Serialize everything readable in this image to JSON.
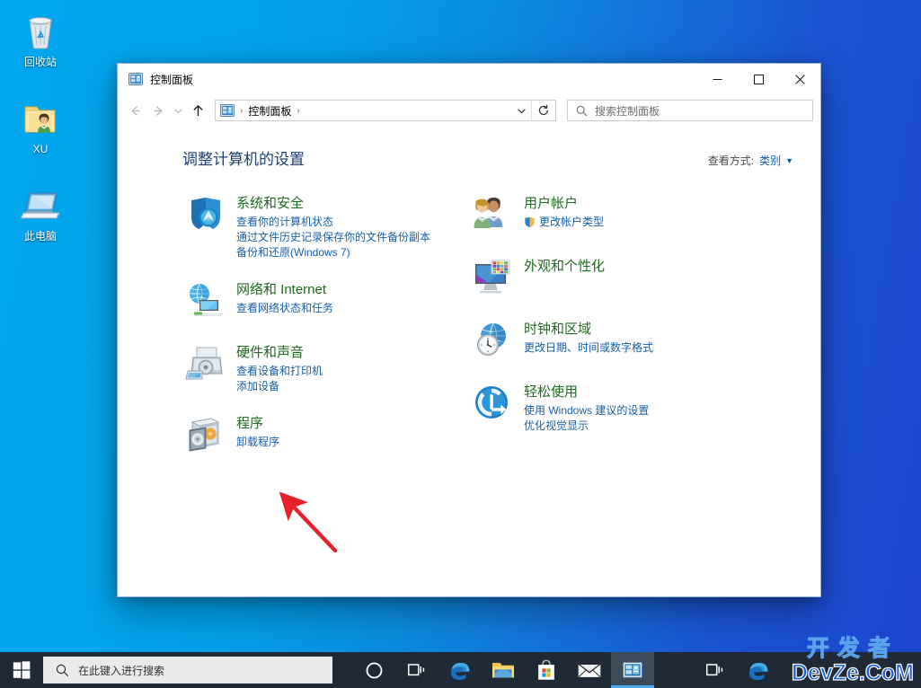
{
  "desktop": {
    "icons": [
      {
        "label": "回收站",
        "icon": "recycle-bin-icon"
      },
      {
        "label": "XU",
        "icon": "user-folder-icon"
      },
      {
        "label": "此电脑",
        "icon": "this-pc-icon"
      }
    ]
  },
  "window": {
    "title": "控制面板",
    "icon": "control-panel-icon",
    "controls": {
      "minimize": "minimize-icon",
      "maximize": "maximize-icon",
      "close": "close-icon"
    },
    "nav": {
      "back": "back-arrow-icon",
      "forward": "forward-arrow-icon",
      "recent": "recent-chevron-icon",
      "up": "up-arrow-icon",
      "refresh": "refresh-icon",
      "dropdown": "address-chevron-icon"
    },
    "address": {
      "icon": "control-panel-icon",
      "crumbs": [
        "控制面板"
      ],
      "separator": "›"
    },
    "search": {
      "icon": "search-icon",
      "placeholder": "搜索控制面板",
      "value": ""
    }
  },
  "main": {
    "heading": "调整计算机的设置",
    "view_by": {
      "label": "查看方式:",
      "value": "类别",
      "caret": "▼"
    },
    "left_column": [
      {
        "icon": "system-security-shield-icon",
        "title": "系统和安全",
        "links": [
          {
            "text": "查看你的计算机状态",
            "shield": false
          },
          {
            "text": "通过文件历史记录保存你的文件备份副本",
            "shield": false
          },
          {
            "text": "备份和还原(Windows 7)",
            "shield": false
          }
        ]
      },
      {
        "icon": "network-internet-icon",
        "title": "网络和 Internet",
        "links": [
          {
            "text": "查看网络状态和任务",
            "shield": false
          }
        ]
      },
      {
        "icon": "hardware-sound-printer-icon",
        "title": "硬件和声音",
        "links": [
          {
            "text": "查看设备和打印机",
            "shield": false
          },
          {
            "text": "添加设备",
            "shield": false
          }
        ]
      },
      {
        "icon": "programs-cd-box-icon",
        "title": "程序",
        "links": [
          {
            "text": "卸载程序",
            "shield": false
          }
        ]
      }
    ],
    "right_column": [
      {
        "icon": "user-accounts-people-icon",
        "title": "用户帐户",
        "links": [
          {
            "text": "更改帐户类型",
            "shield": true
          }
        ]
      },
      {
        "icon": "appearance-personalization-icon",
        "title": "外观和个性化",
        "links": []
      },
      {
        "icon": "clock-region-globe-icon",
        "title": "时钟和区域",
        "links": [
          {
            "text": "更改日期、时间或数字格式",
            "shield": false
          }
        ]
      },
      {
        "icon": "ease-of-access-icon",
        "title": "轻松使用",
        "links": [
          {
            "text": "使用 Windows 建议的设置",
            "shield": false
          },
          {
            "text": "优化视觉显示",
            "shield": false
          }
        ]
      }
    ]
  },
  "annotation": {
    "type": "red-arrow",
    "points_to": "程序",
    "color": "#e8202a"
  },
  "taskbar": {
    "start": "windows-start-icon",
    "search": {
      "icon": "search-icon",
      "placeholder": "在此键入进行搜索"
    },
    "buttons": [
      {
        "name": "cortana-icon",
        "active": false
      },
      {
        "name": "task-view-icon",
        "active": false
      },
      {
        "name": "edge-browser-icon",
        "active": false
      },
      {
        "name": "file-explorer-icon",
        "active": false
      },
      {
        "name": "microsoft-store-icon",
        "active": false
      },
      {
        "name": "mail-icon",
        "active": false
      },
      {
        "name": "control-panel-taskbar-icon",
        "active": true
      },
      {
        "name": "task-view-icon-2",
        "active": false
      },
      {
        "name": "edge-browser-icon-2",
        "active": false
      }
    ]
  },
  "watermark": {
    "line1": "开发者",
    "line2": "DevZe.CoM",
    "color": "#1a5fd6"
  },
  "colors": {
    "desktop_left": "#00a6ee",
    "desktop_right": "#1c45cf",
    "taskbar": "#1f2a36",
    "category_title": "#1f6b1f",
    "link": "#1560a8",
    "heading": "#1f3f73",
    "accent": "#53a8e6"
  }
}
